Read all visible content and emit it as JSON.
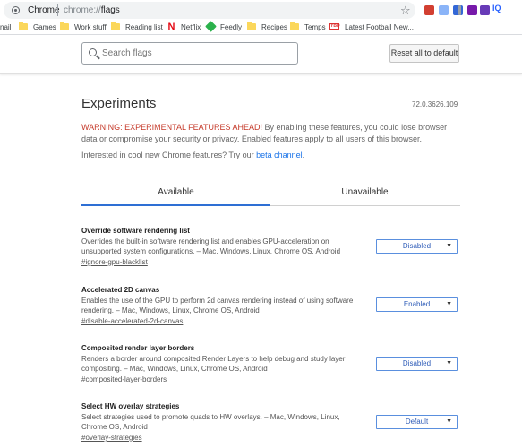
{
  "browser": {
    "site_label": "Chrome",
    "url_scheme": "chrome://",
    "url_path": "flags",
    "star_icon": "bookmark-star-icon",
    "extensions": [
      {
        "name": "red-extension-icon",
        "color": "#d23f31"
      },
      {
        "name": "lightblue-extension-icon",
        "color": "#8ab4f8"
      },
      {
        "name": "blue-extension-icon",
        "color": "#3367d6"
      },
      {
        "name": "gray-extension-icon",
        "color": "#9aa0a6"
      },
      {
        "name": "onenote-extension-icon",
        "color": "#7719aa"
      },
      {
        "name": "purple-extension-icon",
        "color": "#673ab7"
      }
    ],
    "iq_label": "IQ",
    "iq_color": "#2962ff"
  },
  "bookmarks": [
    {
      "label": "nail",
      "icon": "none"
    },
    {
      "label": "Games",
      "icon": "folder-icon"
    },
    {
      "label": "Work stuff",
      "icon": "folder-icon"
    },
    {
      "label": "Reading list",
      "icon": "folder-icon"
    },
    {
      "label": "Netflix",
      "icon": "netflix-icon"
    },
    {
      "label": "Feedly",
      "icon": "feedly-icon"
    },
    {
      "label": "Recipes",
      "icon": "folder-icon"
    },
    {
      "label": "Temps",
      "icon": "folder-icon"
    },
    {
      "label": "Latest Football New...",
      "icon": "news-site-icon"
    }
  ],
  "header": {
    "search_placeholder": "Search flags",
    "reset_label": "Reset all to default"
  },
  "main": {
    "title": "Experiments",
    "version": "72.0.3626.109",
    "warning_strong": "WARNING: EXPERIMENTAL FEATURES AHEAD!",
    "warning_text": " By enabling these features, you could lose browser data or compromise your security or privacy. Enabled features apply to all users of this browser.",
    "interest_text": "Interested in cool new Chrome features? Try our ",
    "interest_link": "beta channel",
    "interest_end": ".",
    "tabs": [
      {
        "label": "Available",
        "active": true
      },
      {
        "label": "Unavailable",
        "active": false
      }
    ]
  },
  "experiments": [
    {
      "title": "Override software rendering list",
      "description": "Overrides the built-in software rendering list and enables GPU-acceleration on unsupported system configurations. – Mac, Windows, Linux, Chrome OS, Android",
      "link": "#ignore-gpu-blacklist",
      "value": "Disabled"
    },
    {
      "title": "Accelerated 2D canvas",
      "description": "Enables the use of the GPU to perform 2d canvas rendering instead of using software rendering. – Mac, Windows, Linux, Chrome OS, Android",
      "link": "#disable-accelerated-2d-canvas",
      "value": "Enabled"
    },
    {
      "title": "Composited render layer borders",
      "description": "Renders a border around composited Render Layers to help debug and study layer compositing. – Mac, Windows, Linux, Chrome OS, Android",
      "link": "#composited-layer-borders",
      "value": "Disabled"
    },
    {
      "title": "Select HW overlay strategies",
      "description": "Select strategies used to promote quads to HW overlays. – Mac, Windows, Linux, Chrome OS, Android",
      "link": "#overlay-strategies",
      "value": "Default"
    }
  ]
}
